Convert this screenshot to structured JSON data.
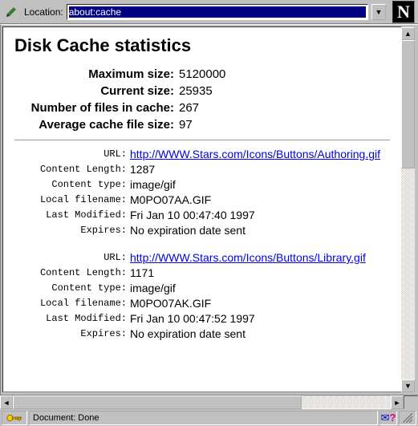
{
  "toolbar": {
    "location_label": "Location:",
    "location_value": "about:cache",
    "netscape_n": "N"
  },
  "page": {
    "heading": "Disk Cache statistics",
    "stats": [
      {
        "label": "Maximum size:",
        "value": "5120000"
      },
      {
        "label": "Current size:",
        "value": "25935"
      },
      {
        "label": "Number of files in cache:",
        "value": "267"
      },
      {
        "label": "Average cache file size:",
        "value": "97"
      }
    ],
    "field_labels": {
      "url": "URL:",
      "content_length": "Content Length:",
      "content_type": "Content type:",
      "local_filename": "Local filename:",
      "last_modified": "Last Modified:",
      "expires": "Expires:"
    },
    "entries": [
      {
        "url": "http://WWW.Stars.com/Icons/Buttons/Authoring.gif",
        "content_length": "1287",
        "content_type": "image/gif",
        "local_filename": "M0PO07AA.GIF",
        "last_modified": "Fri Jan 10 00:47:40 1997",
        "expires": "No expiration date sent"
      },
      {
        "url": "http://WWW.Stars.com/Icons/Buttons/Library.gif",
        "content_length": "1171",
        "content_type": "image/gif",
        "local_filename": "M0PO07AK.GIF",
        "last_modified": "Fri Jan 10 00:47:52 1997",
        "expires": "No expiration date sent"
      }
    ]
  },
  "statusbar": {
    "text": "Document: Done",
    "mail_glyph": "✉",
    "q_glyph": "?"
  }
}
